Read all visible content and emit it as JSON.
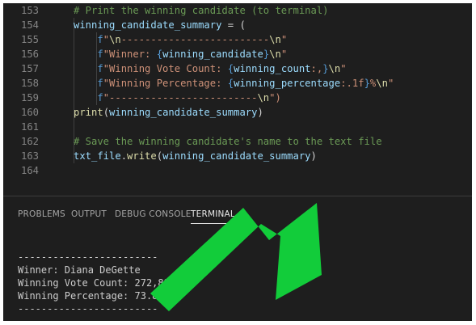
{
  "editor": {
    "lines": [
      {
        "num": "153",
        "tokens": [
          {
            "t": "# Print the winning candidate (to terminal)",
            "c": "c"
          }
        ]
      },
      {
        "num": "154",
        "tokens": [
          {
            "t": "winning_candidate_summary",
            "c": "v"
          },
          {
            "t": " = (",
            "c": "p"
          }
        ]
      },
      {
        "num": "155",
        "tokens": [
          {
            "t": "    f",
            "c": "sp"
          },
          {
            "t": "\"",
            "c": "s"
          },
          {
            "t": "\\n",
            "c": "f"
          },
          {
            "t": "-------------------------",
            "c": "s"
          },
          {
            "t": "\\n",
            "c": "f"
          },
          {
            "t": "\"",
            "c": "s"
          }
        ]
      },
      {
        "num": "156",
        "tokens": [
          {
            "t": "    f",
            "c": "sp"
          },
          {
            "t": "\"Winner: ",
            "c": "s"
          },
          {
            "t": "{",
            "c": "sp"
          },
          {
            "t": "winning_candidate",
            "c": "v"
          },
          {
            "t": "}",
            "c": "sp"
          },
          {
            "t": "\\n",
            "c": "f"
          },
          {
            "t": "\"",
            "c": "s"
          }
        ]
      },
      {
        "num": "157",
        "tokens": [
          {
            "t": "    f",
            "c": "sp"
          },
          {
            "t": "\"Winning Vote Count: ",
            "c": "s"
          },
          {
            "t": "{",
            "c": "sp"
          },
          {
            "t": "winning_count",
            "c": "v"
          },
          {
            "t": ":,",
            "c": "s"
          },
          {
            "t": "}",
            "c": "sp"
          },
          {
            "t": "\\n",
            "c": "f"
          },
          {
            "t": "\"",
            "c": "s"
          }
        ]
      },
      {
        "num": "158",
        "tokens": [
          {
            "t": "    f",
            "c": "sp"
          },
          {
            "t": "\"Winning Percentage: ",
            "c": "s"
          },
          {
            "t": "{",
            "c": "sp"
          },
          {
            "t": "winning_percentage",
            "c": "v"
          },
          {
            "t": ":.1f",
            "c": "s"
          },
          {
            "t": "}",
            "c": "sp"
          },
          {
            "t": "%",
            "c": "s"
          },
          {
            "t": "\\n",
            "c": "f"
          },
          {
            "t": "\"",
            "c": "s"
          }
        ]
      },
      {
        "num": "159",
        "tokens": [
          {
            "t": "    f",
            "c": "sp"
          },
          {
            "t": "\"-------------------------",
            "c": "s"
          },
          {
            "t": "\\n",
            "c": "f"
          },
          {
            "t": "\")",
            "c": "s"
          }
        ]
      },
      {
        "num": "160",
        "tokens": [
          {
            "t": "print",
            "c": "fn"
          },
          {
            "t": "(",
            "c": "p"
          },
          {
            "t": "winning_candidate_summary",
            "c": "v"
          },
          {
            "t": ")",
            "c": "p"
          }
        ]
      },
      {
        "num": "161",
        "tokens": []
      },
      {
        "num": "162",
        "tokens": [
          {
            "t": "# Save the winning candidate's name to the text file",
            "c": "c"
          }
        ]
      },
      {
        "num": "163",
        "tokens": [
          {
            "t": "txt_file",
            "c": "v"
          },
          {
            "t": ".",
            "c": "p"
          },
          {
            "t": "write",
            "c": "fn"
          },
          {
            "t": "(",
            "c": "p"
          },
          {
            "t": "winning_candidate_summary",
            "c": "v"
          },
          {
            "t": ")",
            "c": "p"
          }
        ]
      },
      {
        "num": "164",
        "tokens": []
      }
    ]
  },
  "panel": {
    "tabs": [
      {
        "label": "PROBLEMS",
        "active": false
      },
      {
        "label": "OUTPUT",
        "active": false
      },
      {
        "label": "DEBUG CONSOLE",
        "active": false
      },
      {
        "label": "TERMINAL",
        "active": true
      }
    ]
  },
  "terminal": {
    "lines": [
      "------------------------",
      "Winner: Diana DeGette",
      "Winning Vote Count: 272,892",
      "Winning Percentage: 73.8%",
      "------------------------"
    ]
  },
  "annotation": {
    "arrow_color": "#12cc3a"
  }
}
